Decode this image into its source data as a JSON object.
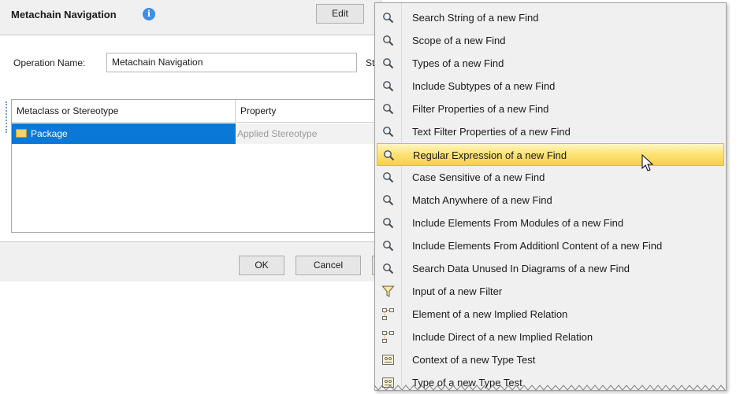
{
  "dialog": {
    "title": "Metachain Navigation",
    "edit_label": "Edit",
    "operation_name_label": "Operation Name:",
    "operation_name_value": "Metachain Navigation",
    "truncated_label": "St",
    "table": {
      "columns": [
        "Metaclass or Stereotype",
        "Property"
      ],
      "rows": [
        {
          "metaclass": "Package",
          "property": "Applied Stereotype"
        }
      ]
    },
    "ok_label": "OK",
    "cancel_label": "Cancel"
  },
  "menu": {
    "highlighted_index": 6,
    "items": [
      {
        "label": "Search String of a new Find",
        "icon": "search-icon"
      },
      {
        "label": "Scope of a new Find",
        "icon": "search-icon"
      },
      {
        "label": "Types of a new Find",
        "icon": "search-icon"
      },
      {
        "label": "Include Subtypes of a new Find",
        "icon": "search-icon"
      },
      {
        "label": "Filter Properties of a new Find",
        "icon": "search-icon"
      },
      {
        "label": "Text Filter Properties of a new Find",
        "icon": "search-icon"
      },
      {
        "label": "Regular Expression of a new Find",
        "icon": "search-icon"
      },
      {
        "label": "Case Sensitive of a new Find",
        "icon": "search-icon"
      },
      {
        "label": "Match Anywhere of a new Find",
        "icon": "search-icon"
      },
      {
        "label": "Include Elements From Modules of a new Find",
        "icon": "search-icon"
      },
      {
        "label": "Include Elements From Additionl Content of a new Find",
        "icon": "search-icon"
      },
      {
        "label": "Search Data Unused In Diagrams of a new Find",
        "icon": "search-icon"
      },
      {
        "label": "Input of a new Filter",
        "icon": "filter-icon"
      },
      {
        "label": "Element of a new Implied Relation",
        "icon": "implied-relation-icon"
      },
      {
        "label": "Include Direct of a new Implied Relation",
        "icon": "implied-relation-icon"
      },
      {
        "label": "Context of a new Type Test",
        "icon": "type-test-icon"
      },
      {
        "label": "Type of a new Type Test",
        "icon": "type-test-icon"
      }
    ]
  },
  "colors": {
    "selection_blue": "#0a78d7",
    "highlight_yellow": "#fde47a",
    "info_blue": "#3d8ee6"
  }
}
